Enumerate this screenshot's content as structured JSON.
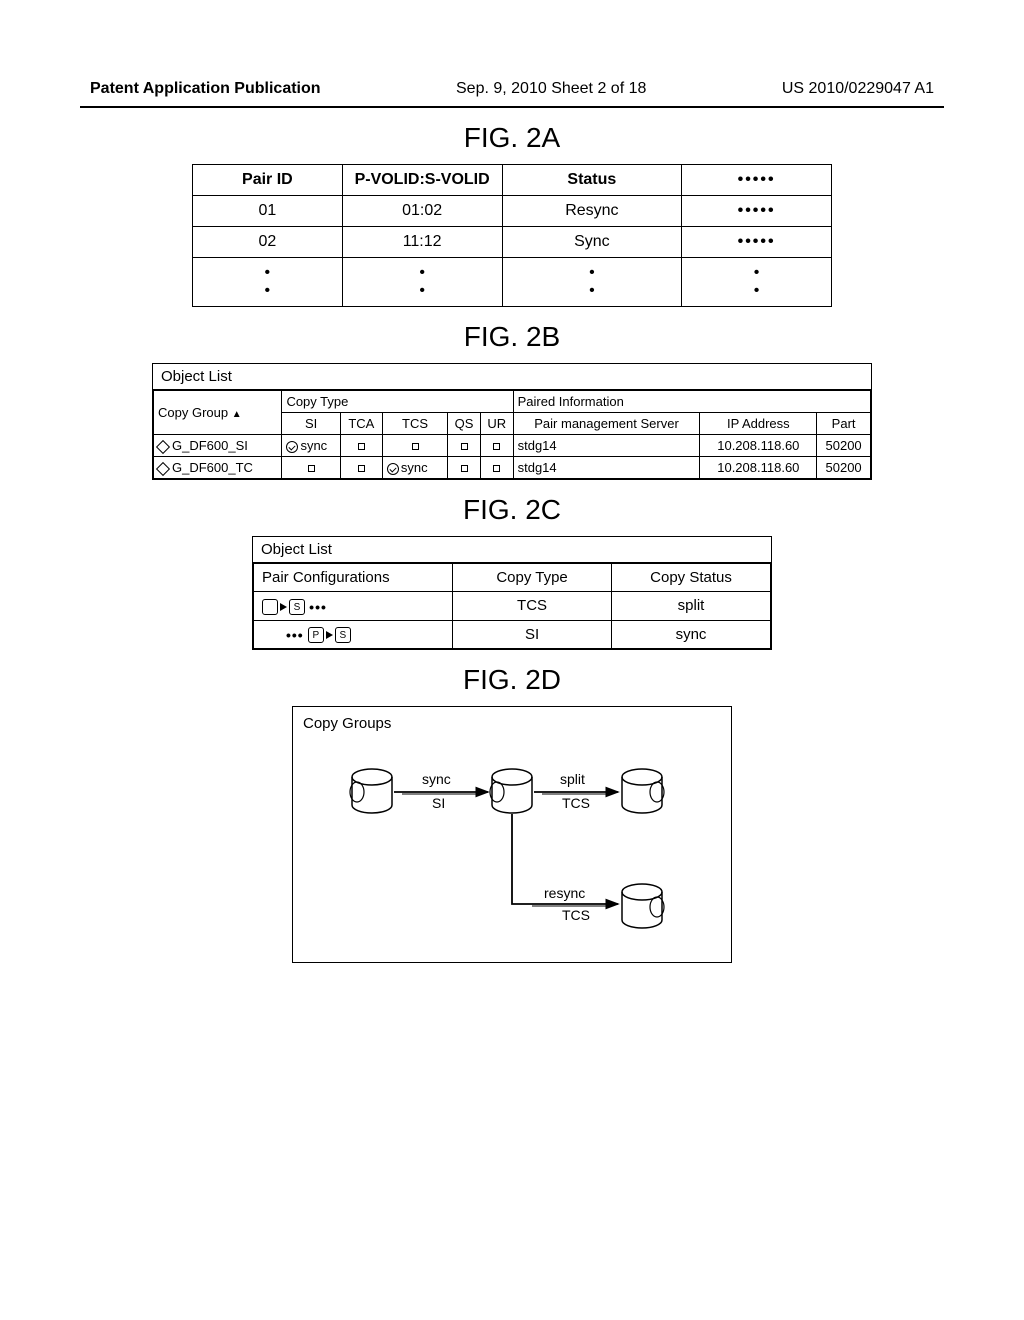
{
  "header": {
    "left": "Patent Application Publication",
    "mid": "Sep. 9, 2010  Sheet 2 of 18",
    "right": "US 2010/0229047 A1"
  },
  "fig2a": {
    "title": "FIG. 2A",
    "headers": {
      "pairid": "Pair ID",
      "pvolid": "P-VOLID:S-VOLID",
      "status": "Status"
    },
    "rows": [
      {
        "pairid": "01",
        "pvolid": "01:02",
        "status": "Resync"
      },
      {
        "pairid": "02",
        "pvolid": "11:12",
        "status": "Sync"
      }
    ]
  },
  "fig2b": {
    "title": "FIG. 2B",
    "panel_title": "Object List",
    "headers": {
      "copygroup": "Copy Group",
      "copytype": "Copy Type",
      "si": "SI",
      "tca": "TCA",
      "tcs": "TCS",
      "qs": "QS",
      "ur": "UR",
      "paired": "Paired Information",
      "pms": "Pair management Server",
      "ip": "IP Address",
      "part": "Part"
    },
    "rows": [
      {
        "group": "G_DF600_SI",
        "si": "sync",
        "tca": "",
        "tcs": "",
        "qs": "",
        "ur": "",
        "pms": "stdg14",
        "ip": "10.208.118.60",
        "part": "50200"
      },
      {
        "group": "G_DF600_TC",
        "si": "",
        "tca": "",
        "tcs": "sync",
        "qs": "",
        "ur": "",
        "pms": "stdg14",
        "ip": "10.208.118.60",
        "part": "50200"
      }
    ]
  },
  "fig2c": {
    "title": "FIG. 2C",
    "panel_title": "Object List",
    "headers": {
      "pc": "Pair Configurations",
      "ct": "Copy Type",
      "cs": "Copy Status"
    },
    "rows": [
      {
        "ct": "TCS",
        "cs": "split"
      },
      {
        "ct": "SI",
        "cs": "sync"
      }
    ]
  },
  "fig2d": {
    "title": "FIG. 2D",
    "panel_title": "Copy Groups",
    "edges": {
      "e1_top": "sync",
      "e1_bot": "SI",
      "e2_top": "split",
      "e2_bot": "TCS",
      "e3_top": "resync",
      "e3_bot": "TCS"
    }
  }
}
